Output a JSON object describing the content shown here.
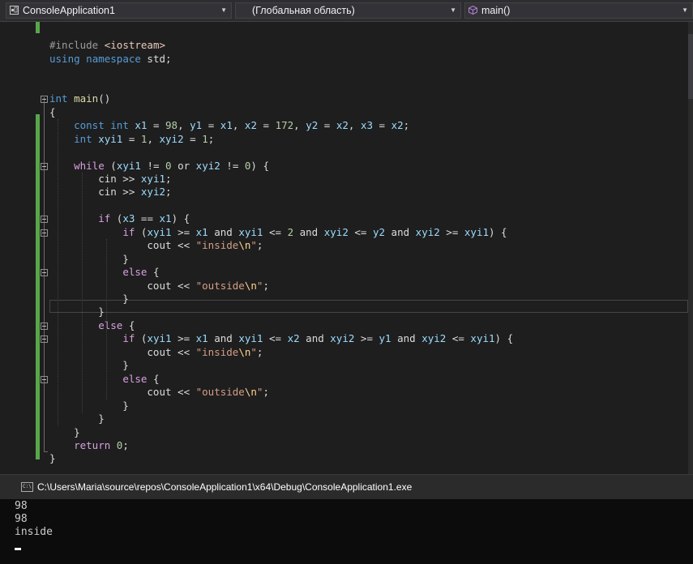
{
  "navbar": {
    "project": "ConsoleApplication1",
    "scope": "(Глобальная область)",
    "member": "main()"
  },
  "code": [
    "",
    "#include <iostream>",
    "using namespace std;",
    "",
    "",
    "int main()",
    "{",
    "    const int x1 = 98, y1 = x1, x2 = 172, y2 = x2, x3 = x2;",
    "    int xyi1 = 1, xyi2 = 1;",
    "",
    "    while (xyi1 != 0 or xyi2 != 0) {",
    "        cin >> xyi1;",
    "        cin >> xyi2;",
    "",
    "        if (x3 == x1) {",
    "            if (xyi1 >= x1 and xyi1 <= 2 and xyi2 <= y2 and xyi2 >= xyi1) {",
    "                cout << \"inside\\n\";",
    "            }",
    "            else {",
    "                cout << \"outside\\n\";",
    "            }",
    "        }",
    "        else {",
    "            if (xyi1 >= x1 and xyi1 <= x2 and xyi2 >= y1 and xyi2 <= xyi1) {",
    "                cout << \"inside\\n\";",
    "            }",
    "            else {",
    "                cout << \"outside\\n\";",
    "            }",
    "        }",
    "    }",
    "    return 0;",
    "}"
  ],
  "console": {
    "title": "C:\\Users\\Maria\\source\\repos\\ConsoleApplication1\\x64\\Debug\\ConsoleApplication1.exe",
    "icon_text": "C:\\",
    "lines": [
      "98",
      "98",
      "inside"
    ]
  },
  "colors": {
    "keyword": "#569cd6",
    "control": "#d8a0df",
    "variable": "#9cdcfe",
    "function": "#dcdcaa",
    "number": "#b5cea8",
    "string": "#d69d85",
    "change_bar": "#57a64a"
  },
  "icons": {
    "project": "project-icon",
    "member": "method-cube-icon",
    "console": "console-window-icon"
  }
}
